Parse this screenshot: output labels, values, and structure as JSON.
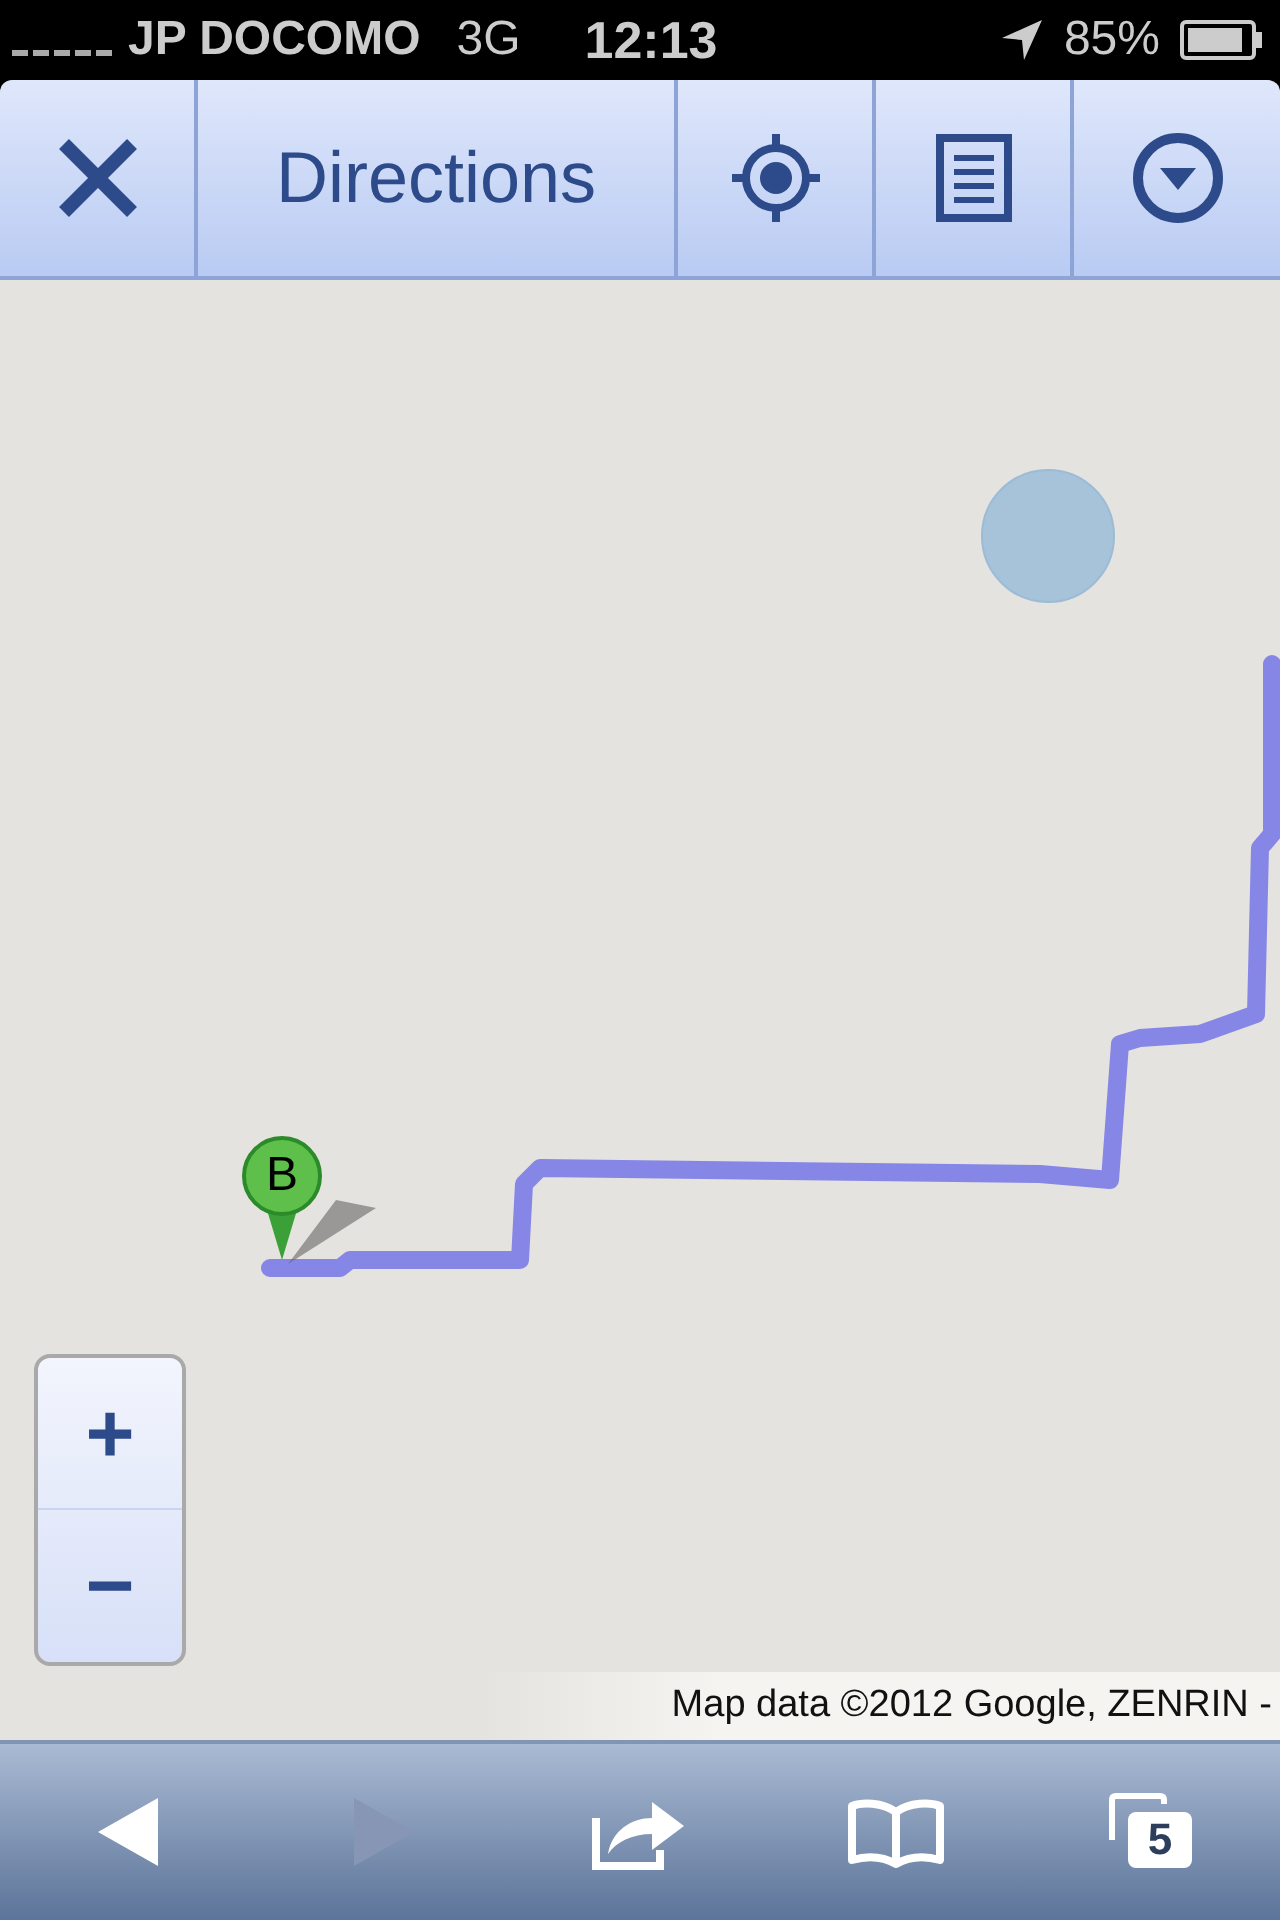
{
  "status_bar": {
    "carrier": "JP DOCOMO",
    "network": "3G",
    "time": "12:13",
    "battery": "85%"
  },
  "toolbar": {
    "items": [
      {
        "kind": "close"
      },
      {
        "kind": "title",
        "label": "Directions"
      },
      {
        "kind": "locate"
      },
      {
        "kind": "list"
      },
      {
        "kind": "menu"
      }
    ]
  },
  "map": {
    "marker": {
      "label": "B"
    },
    "zoom": [
      "+",
      "−"
    ],
    "attribution": "Map data ©2012 Google, ZENRIN -"
  },
  "browser_bar": {
    "items": [
      {
        "kind": "back",
        "disabled": false
      },
      {
        "kind": "forward",
        "disabled": true
      },
      {
        "kind": "share",
        "disabled": false
      },
      {
        "kind": "bookmarks",
        "disabled": false
      },
      {
        "kind": "tabs",
        "disabled": false,
        "count": "5"
      }
    ]
  }
}
